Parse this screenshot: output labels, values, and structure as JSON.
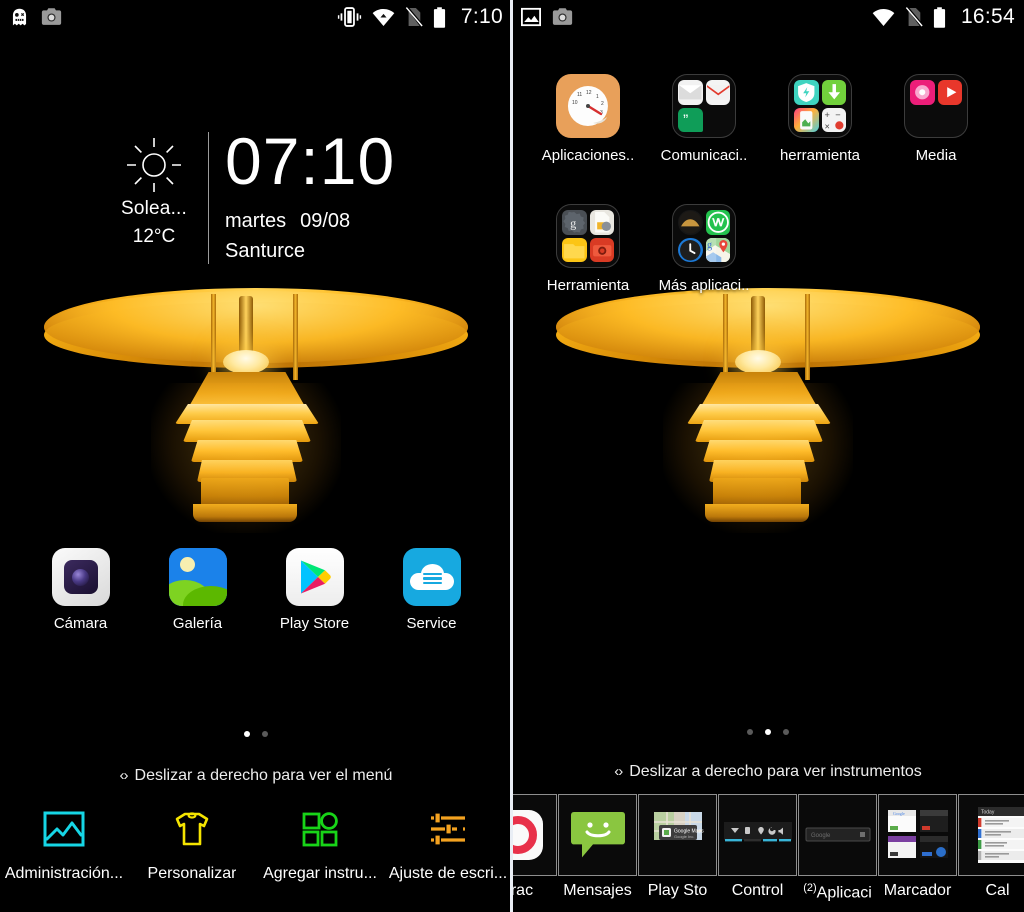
{
  "left_screen": {
    "status_bar": {
      "icons_left": [
        "ghost-notification-icon",
        "camera-icon"
      ],
      "icons_right": [
        "vibrate-icon",
        "wifi-icon",
        "no-sim-icon",
        "battery-icon"
      ],
      "time": "7:10"
    },
    "clock_widget": {
      "weather_icon": "sun-icon",
      "weather_label": "Solea...",
      "temperature": "12°C",
      "time": "07:10",
      "day_of_week": "martes",
      "date": "09/08",
      "city": "Santurce"
    },
    "dock_apps": [
      {
        "label": "Cámara",
        "icon": "camera-app-icon"
      },
      {
        "label": "Galería",
        "icon": "gallery-app-icon"
      },
      {
        "label": "Play Store",
        "icon": "play-store-icon"
      },
      {
        "label": "Service",
        "icon": "service-cloud-icon"
      }
    ],
    "page_dots": {
      "count": 2,
      "active_index": 0
    },
    "hint": {
      "chevrons": "‹›",
      "text": "Deslizar a derecho para ver el menú"
    },
    "toolbar": [
      {
        "label": "Administración...",
        "icon": "wallpaper-icon",
        "color": "#16d6e6"
      },
      {
        "label": "Personalizar",
        "icon": "tshirt-icon",
        "color": "#f5e400"
      },
      {
        "label": "Agregar instru...",
        "icon": "widgets-grid-icon",
        "color": "#18d418"
      },
      {
        "label": "Ajuste de escri...",
        "icon": "sliders-icon",
        "color": "#f4a220"
      }
    ]
  },
  "right_screen": {
    "status_bar": {
      "icons_left": [
        "image-icon",
        "camera-icon"
      ],
      "icons_right": [
        "wifi-icon",
        "no-sim-icon",
        "battery-icon"
      ],
      "time": "16:54"
    },
    "folders_row1": [
      {
        "label": "Aplicaciones..",
        "icon": "speedometer-clock-icon",
        "type": "solid"
      },
      {
        "label": "Comunicaci..",
        "icon": "folder-communication-icon",
        "type": "folder"
      },
      {
        "label": "herramienta",
        "icon": "folder-tools-icon",
        "type": "folder"
      },
      {
        "label": "Media",
        "icon": "folder-media-icon",
        "type": "folder"
      }
    ],
    "folders_row2": [
      {
        "label": "Herramienta",
        "icon": "folder-utilities-icon",
        "type": "folder"
      },
      {
        "label": "Más aplicaci..",
        "icon": "folder-more-apps-icon",
        "type": "folder"
      }
    ],
    "page_dots": {
      "count": 3,
      "active_index": 1
    },
    "hint": {
      "chevrons": "‹›",
      "text": "Deslizar a derecho para ver instrumentos"
    },
    "widget_drawer": [
      {
        "label": "erac",
        "icon": "partial-red-icon"
      },
      {
        "label": "Mensajes",
        "icon": "messaging-icon"
      },
      {
        "label": "Play Sto",
        "icon": "google-maps-widget-icon"
      },
      {
        "label": "Control",
        "icon": "power-control-widget-icon"
      },
      {
        "label": "Aplicaci",
        "prefix": "(2)",
        "icon": "google-search-bar-widget-icon"
      },
      {
        "label": "Marcador",
        "icon": "bookmarks-widget-icon"
      },
      {
        "label": "Cal",
        "icon": "calendar-widget-icon"
      }
    ]
  },
  "colors": {
    "background": "#000000",
    "text": "#ffffff",
    "divider": "#e9eef5",
    "dot_active": "#ffffff",
    "dot_inactive": "#5a5a5a"
  }
}
